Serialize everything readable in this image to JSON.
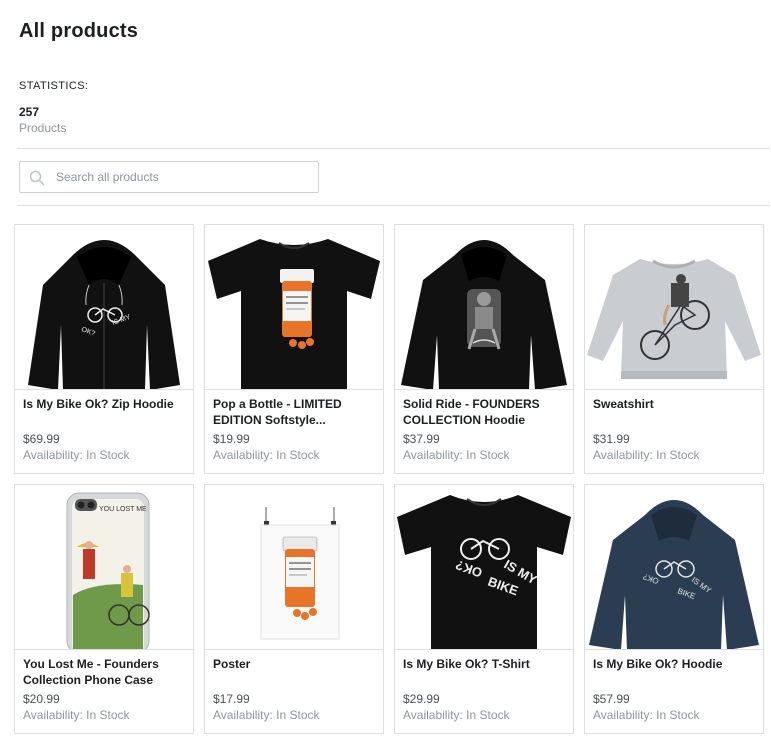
{
  "page": {
    "title": "All products"
  },
  "stats": {
    "label": "STATISTICS:",
    "count": "257",
    "caption": "Products"
  },
  "search": {
    "placeholder": "Search all products",
    "value": "",
    "icon": "search-icon"
  },
  "products": [
    {
      "name": "Is My Bike Ok? Zip Hoodie",
      "price": "$69.99",
      "availability": "Availability: In Stock",
      "image": "black-zip-hoodie-bike"
    },
    {
      "name": "Pop a Bottle - LIMITED EDITION Softstyle...",
      "price": "$19.99",
      "availability": "Availability: In Stock",
      "image": "black-tshirt-pill-bottle"
    },
    {
      "name": "Solid Ride - FOUNDERS COLLECTION Hoodie",
      "price": "$37.99",
      "availability": "Availability: In Stock",
      "image": "black-hoodie-cyclist"
    },
    {
      "name": "Sweatshirt",
      "price": "$31.99",
      "availability": "Availability: In Stock",
      "image": "grey-sweatshirt-cyclist"
    },
    {
      "name": "You Lost Me - Founders Collection Phone Case",
      "price": "$20.99",
      "availability": "Availability: In Stock",
      "image": "phone-case-cyclists"
    },
    {
      "name": "Poster",
      "price": "$17.99",
      "availability": "Availability: In Stock",
      "image": "poster-pill-bottle"
    },
    {
      "name": "Is My Bike Ok? T-Shirt",
      "price": "$29.99",
      "availability": "Availability: In Stock",
      "image": "black-tshirt-bike"
    },
    {
      "name": "Is My Bike Ok? Hoodie",
      "price": "$57.99",
      "availability": "Availability: In Stock",
      "image": "navy-hoodie-bike"
    }
  ]
}
